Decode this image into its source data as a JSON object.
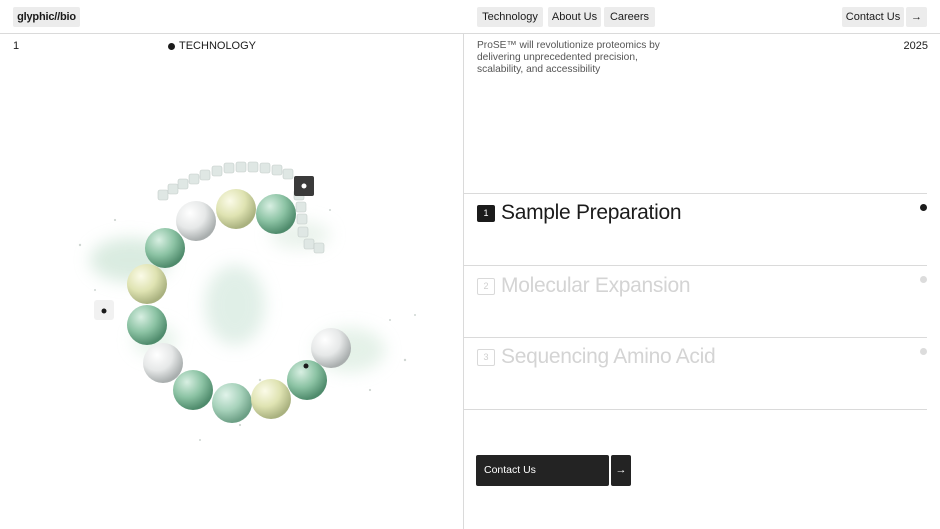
{
  "header": {
    "logo": "glyphic//bio",
    "nav": [
      "Technology",
      "About Us",
      "Careers"
    ],
    "contact_label": "Contact Us",
    "arrow": "→"
  },
  "left": {
    "index": "1",
    "section_label": "TECHNOLOGY"
  },
  "right": {
    "tagline": "ProSE™ will revolutionize proteomics by delivering unprecedented precision, scalability, and accessibility",
    "year": "2025",
    "steps": [
      {
        "num": "1",
        "title": "Sample Preparation",
        "active": true
      },
      {
        "num": "2",
        "title": "Molecular Expansion",
        "active": false
      },
      {
        "num": "3",
        "title": "Sequencing Amino Acid",
        "active": false
      }
    ],
    "cta_label": "Contact Us",
    "cta_arrow": "→"
  },
  "colors": {
    "accent_dark": "#1b1b1b",
    "muted": "#d4d4d4",
    "bead_green": "#7fb89a",
    "bead_yellow": "#e3e6b8",
    "bead_white": "#eceeee"
  },
  "icons": {
    "arrow": "arrow-right-icon",
    "dot": "dot-icon"
  }
}
